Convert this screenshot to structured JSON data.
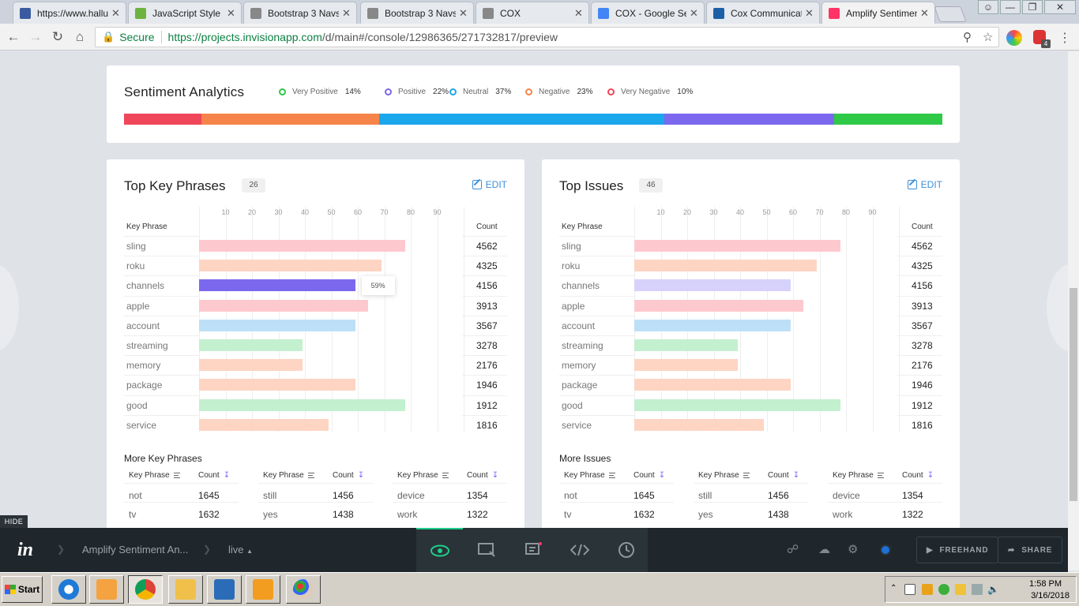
{
  "browser": {
    "tabs": [
      {
        "title": "https://www.hallu",
        "icon_color": "#3a5ba0"
      },
      {
        "title": "JavaScript Style G",
        "icon_color": "#6cb33f"
      },
      {
        "title": "Bootstrap 3 Navs",
        "icon_color": "#888888"
      },
      {
        "title": "Bootstrap 3 Navs",
        "icon_color": "#888888"
      },
      {
        "title": "COX",
        "icon_color": "#888888"
      },
      {
        "title": "COX - Google Sea",
        "icon_color": "#4285f4"
      },
      {
        "title": "Cox Communicatio",
        "icon_color": "#1b5fa7"
      },
      {
        "title": "Amplify Sentimen",
        "icon_color": "#ff3366",
        "active": true
      }
    ],
    "secure_label": "Secure",
    "url_host": "https://projects.invisionapp.com",
    "url_path": "/d/main#/console/12986365/271732817/preview",
    "badge_count": "4"
  },
  "sentiment": {
    "title": "Sentiment Analytics",
    "legend": [
      {
        "label": "Very Positive",
        "pct": "14%",
        "color": "#2ec946"
      },
      {
        "label": "Positive",
        "pct": "22%",
        "color": "#7b68ee"
      },
      {
        "label": "Neutral",
        "pct": "37%",
        "color": "#1aa7ec"
      },
      {
        "label": "Negative",
        "pct": "23%",
        "color": "#f6844a"
      },
      {
        "label": "Very Negative",
        "pct": "10%",
        "color": "#f0465a"
      }
    ],
    "stacked_bar": [
      {
        "color": "#f0465a",
        "share": 10
      },
      {
        "color": "#f6844a",
        "share": 23
      },
      {
        "color": "#1aa7ec",
        "share": 37
      },
      {
        "color": "#7b68ee",
        "share": 22
      },
      {
        "color": "#2ec946",
        "share": 14
      }
    ]
  },
  "phrases": {
    "title": "Top Key Phrases",
    "count": "26",
    "edit_label": "EDIT",
    "col_key": "Key Phrase",
    "col_count": "Count",
    "ticks": [
      "10",
      "20",
      "30",
      "40",
      "50",
      "60",
      "70",
      "80",
      "90"
    ],
    "rows": [
      {
        "label": "sling",
        "value": 78,
        "count": "4562",
        "color": "#fdc9cf"
      },
      {
        "label": "roku",
        "value": 69,
        "count": "4325",
        "color": "#fed4c2"
      },
      {
        "label": "channels",
        "value": 59,
        "count": "4156",
        "color": "#7b68ee"
      },
      {
        "label": "apple",
        "value": 64,
        "count": "3913",
        "color": "#fdc9cf"
      },
      {
        "label": "account",
        "value": 59,
        "count": "3567",
        "color": "#bde0f7"
      },
      {
        "label": "streaming",
        "value": 39,
        "count": "3278",
        "color": "#c3f0cf"
      },
      {
        "label": "memory",
        "value": 39,
        "count": "2176",
        "color": "#fed4c2"
      },
      {
        "label": "package",
        "value": 59,
        "count": "1946",
        "color": "#fed4c2"
      },
      {
        "label": "good",
        "value": 78,
        "count": "1912",
        "color": "#c3f0cf"
      },
      {
        "label": "service",
        "value": 49,
        "count": "1816",
        "color": "#fed4c2"
      }
    ],
    "tooltip": "59%",
    "more_title": "More Key Phrases",
    "more": [
      {
        "key": "not",
        "count": "1645"
      },
      {
        "key": "tv",
        "count": "1632"
      },
      {
        "key": "still",
        "count": "1456"
      },
      {
        "key": "yes",
        "count": "1438"
      },
      {
        "key": "device",
        "count": "1354"
      },
      {
        "key": "work",
        "count": "1322"
      }
    ]
  },
  "issues": {
    "title": "Top Issues",
    "count": "46",
    "edit_label": "EDIT",
    "col_key": "Key Phrase",
    "col_count": "Count",
    "ticks": [
      "10",
      "20",
      "30",
      "40",
      "50",
      "60",
      "70",
      "80",
      "90"
    ],
    "rows": [
      {
        "label": "sling",
        "value": 78,
        "count": "4562",
        "color": "#fdc9cf"
      },
      {
        "label": "roku",
        "value": 69,
        "count": "4325",
        "color": "#fed4c2"
      },
      {
        "label": "channels",
        "value": 59,
        "count": "4156",
        "color": "#d6d2fb"
      },
      {
        "label": "apple",
        "value": 64,
        "count": "3913",
        "color": "#fdc9cf"
      },
      {
        "label": "account",
        "value": 59,
        "count": "3567",
        "color": "#bde0f7"
      },
      {
        "label": "streaming",
        "value": 39,
        "count": "3278",
        "color": "#c3f0cf"
      },
      {
        "label": "memory",
        "value": 39,
        "count": "2176",
        "color": "#fed4c2"
      },
      {
        "label": "package",
        "value": 59,
        "count": "1946",
        "color": "#fed4c2"
      },
      {
        "label": "good",
        "value": 78,
        "count": "1912",
        "color": "#c3f0cf"
      },
      {
        "label": "service",
        "value": 49,
        "count": "1816",
        "color": "#fed4c2"
      }
    ],
    "more_title": "More Issues",
    "more": [
      {
        "key": "not",
        "count": "1645"
      },
      {
        "key": "tv",
        "count": "1632"
      },
      {
        "key": "still",
        "count": "1456"
      },
      {
        "key": "yes",
        "count": "1438"
      },
      {
        "key": "device",
        "count": "1354"
      },
      {
        "key": "work",
        "count": "1322"
      }
    ]
  },
  "invision": {
    "hide_label": "HIDE",
    "logo": "in",
    "project": "Amplify Sentiment An...",
    "mode": "live",
    "freehand_label": "FREEHAND",
    "share_label": "SHARE"
  },
  "taskbar": {
    "start_label": "Start",
    "time": "1:58 PM",
    "date": "3/16/2018"
  }
}
